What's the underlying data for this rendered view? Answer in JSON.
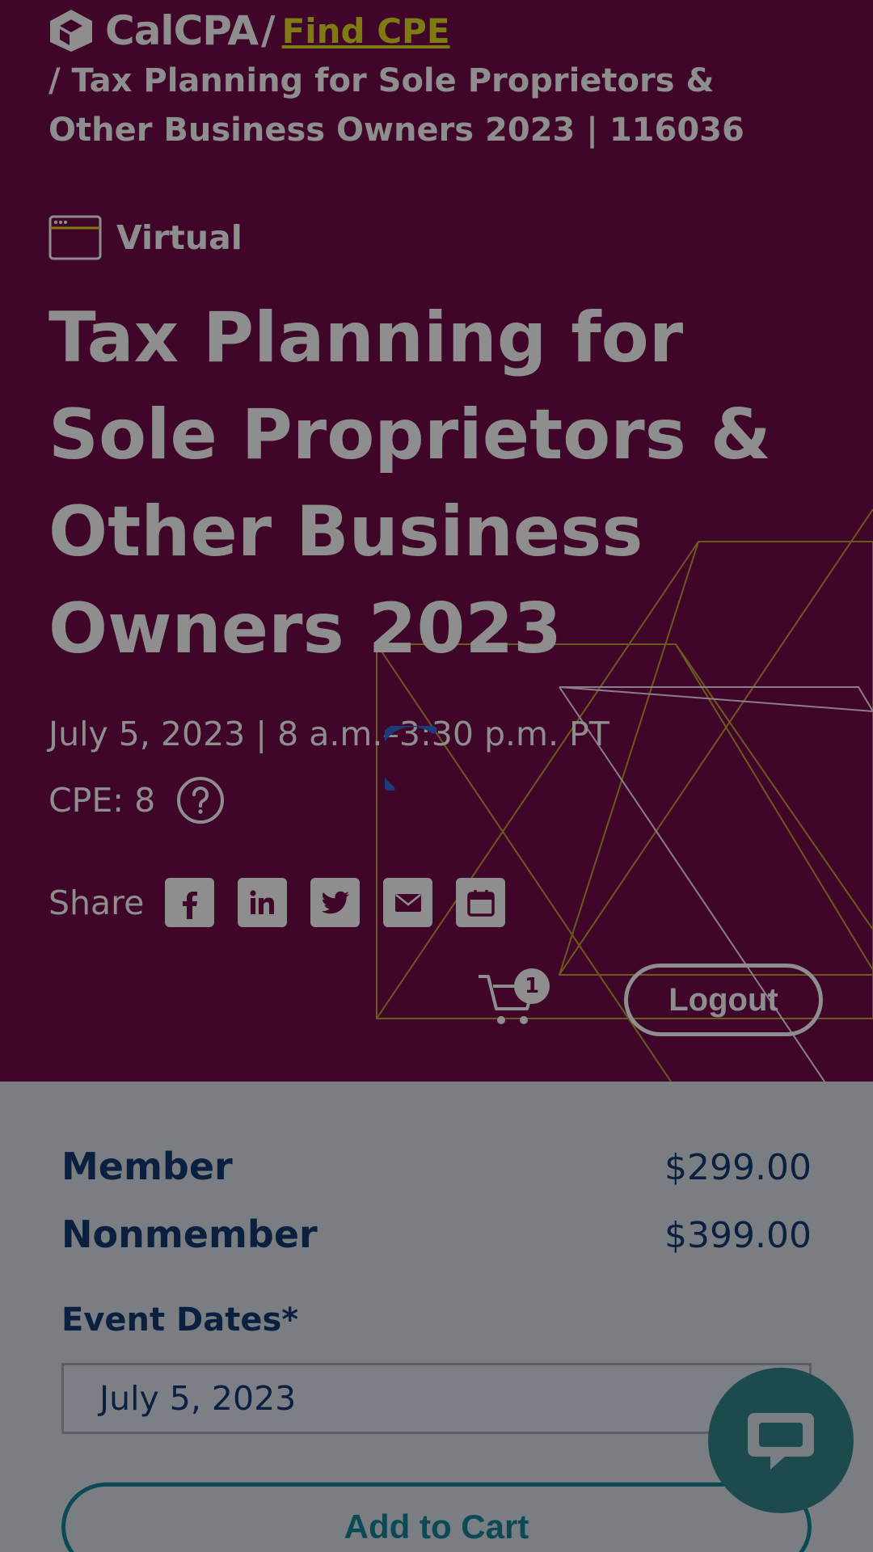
{
  "breadcrumb": {
    "brand": "CalCPA",
    "separator": "/",
    "find_cpe": "Find CPE",
    "current": "/ Tax Planning for Sole Proprietors & Other Business Owners 2023 | 116036"
  },
  "event": {
    "format": "Virtual",
    "title": "Tax Planning for Sole Proprietors & Other Business Owners 2023",
    "datetime": "July 5, 2023 | 8 a.m.–3:30 p.m. PT",
    "cpe": "CPE: 8"
  },
  "share": {
    "label": "Share",
    "icons": [
      "facebook-icon",
      "linkedin-icon",
      "twitter-icon",
      "email-icon",
      "calendar-icon"
    ]
  },
  "cart": {
    "count": "1"
  },
  "header": {
    "logout_label": "Logout"
  },
  "pricing": {
    "rows": [
      {
        "label": "Member",
        "price": "$299.00"
      },
      {
        "label": "Nonmember",
        "price": "$399.00"
      }
    ],
    "event_dates_label": "Event Dates*",
    "selected_date": "July 5, 2023",
    "add_to_cart_label": "Add to Cart"
  },
  "colors": {
    "hero_bg": "#40062a",
    "accent_olive": "#7d7b12",
    "text_navy": "#0b1f3e",
    "teal": "#0b4a55",
    "overlay_grey": "#7a7e83"
  }
}
